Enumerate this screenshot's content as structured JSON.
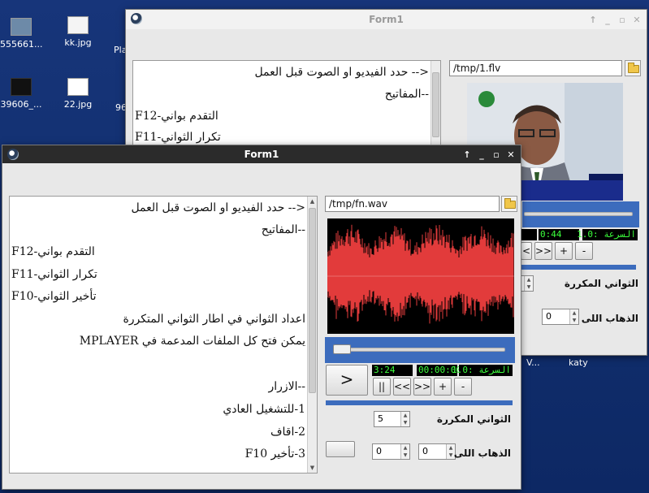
{
  "desktop": {
    "icons": [
      {
        "label": "555661..."
      },
      {
        "label": "kk.jpg"
      },
      {
        "label": "Pla"
      },
      {
        "label": "39606_..."
      },
      {
        "label": "22.jpg"
      },
      {
        "label": "96"
      }
    ],
    "bottom_labels": {
      "v": "V...",
      "katy": "katy"
    }
  },
  "back_window": {
    "title": "Form1",
    "lines": [
      "<-- حدد الفيديو او الصوت قبل العمل",
      "--المفاتيح",
      "التقدم  بواني-F12",
      "تكرار الثواني-F11"
    ],
    "path": "/tmp/1.flv",
    "time": "0:44",
    "speed": "السرعة :1.0",
    "btn_rew": "<<",
    "btn_ff": ">>",
    "btn_plus": "+",
    "btn_minus": "-",
    "repeat_label": "الثواني المكررة",
    "goto_label": "الذهاب اللى",
    "goto_value": "0"
  },
  "front_window": {
    "title": "Form1",
    "lines": [
      "<-- حدد الفيديو او الصوت قبل العمل",
      "--المفاتيح",
      "التقدم  بواني-F12",
      "تكرار الثواني-F11",
      "تأخير الثواني-F10",
      "اعداد الثواني في اطار الثواني المتكررة",
      "يمكن فتح كل الملفات المدعمة في MPLAYER",
      "",
      "--الازرار",
      "1-للتشغيل العادي",
      "2-اقاف",
      "3-تأخير F10"
    ],
    "path": "/tmp/fn.wav",
    "duration": "3:24",
    "position": "00:00:00",
    "speed": "السرعة :1.0",
    "btn_play": ">",
    "btn_pause": "||",
    "btn_rew": "<<",
    "btn_ff": ">>",
    "btn_plus": "+",
    "btn_minus": "-",
    "repeat_label": "الثواني المكررة",
    "repeat_value": "5",
    "goto_label": "الذهاب اللى",
    "goto_value_1": "0",
    "goto_value_2": "0",
    "progress_fraction": 0.0
  },
  "colors": {
    "waveform": "#e23b3b",
    "lcd_text": "#3cff3c",
    "accent_band": "#3c6cbd"
  }
}
